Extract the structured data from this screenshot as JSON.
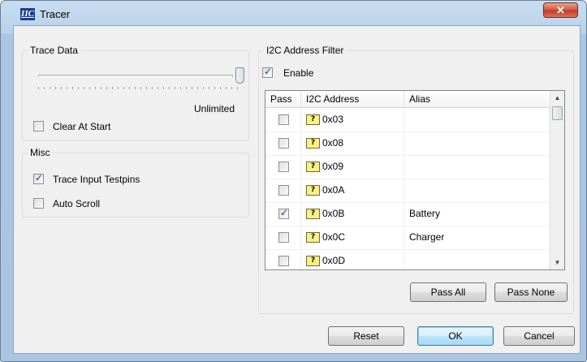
{
  "window": {
    "title": "Tracer",
    "logo_text": "IIC",
    "close_glyph": "✕"
  },
  "trace_data": {
    "group_title": "Trace Data",
    "slider_value_label": "Unlimited",
    "slider_level": 1.0,
    "clear_at_start": {
      "label": "Clear At Start",
      "checked": false
    }
  },
  "misc": {
    "group_title": "Misc",
    "trace_input_testpins": {
      "label": "Trace Input Testpins",
      "checked": true
    },
    "auto_scroll": {
      "label": "Auto Scroll",
      "checked": false
    }
  },
  "filter": {
    "group_title": "I2C Address Filter",
    "enable": {
      "label": "Enable",
      "checked": true
    },
    "columns": {
      "pass": "Pass",
      "address": "I2C Address",
      "alias": "Alias"
    },
    "icon_glyph": "?",
    "rows": [
      {
        "pass": false,
        "address": "0x03",
        "alias": ""
      },
      {
        "pass": false,
        "address": "0x08",
        "alias": ""
      },
      {
        "pass": false,
        "address": "0x09",
        "alias": ""
      },
      {
        "pass": false,
        "address": "0x0A",
        "alias": ""
      },
      {
        "pass": true,
        "address": "0x0B",
        "alias": "Battery"
      },
      {
        "pass": false,
        "address": "0x0C",
        "alias": "Charger"
      },
      {
        "pass": false,
        "address": "0x0D",
        "alias": ""
      }
    ],
    "pass_all_label": "Pass All",
    "pass_none_label": "Pass None"
  },
  "footer": {
    "reset_label": "Reset",
    "ok_label": "OK",
    "cancel_label": "Cancel"
  }
}
